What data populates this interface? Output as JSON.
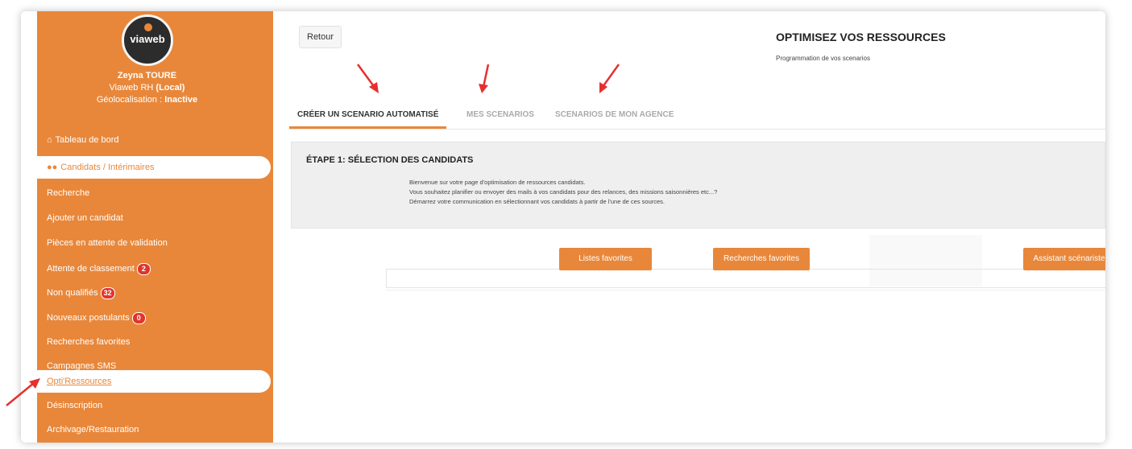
{
  "sidebar": {
    "logo_text": "viaweb",
    "user_name": "Zeyna TOURE",
    "user_role_prefix": "Viaweb RH ",
    "user_role_suffix": "(Local)",
    "geo_prefix": "Géolocalisation : ",
    "geo_status": "Inactive",
    "items": [
      {
        "label": "Tableau de bord",
        "icon": "home-icon"
      },
      {
        "label": "Candidats / Intérimaires",
        "icon": "users-icon"
      },
      {
        "label": "Recherche"
      },
      {
        "label": "Ajouter un candidat"
      },
      {
        "label": "Pièces en attente de validation"
      },
      {
        "label": "Attente de classement",
        "badge": "2"
      },
      {
        "label": "Non qualifiés",
        "badge": "32"
      },
      {
        "label": "Nouveaux postulants",
        "badge": "0"
      },
      {
        "label": "Recherches favorites"
      },
      {
        "label": "Campagnes SMS"
      },
      {
        "label": "Opti'Ressources"
      },
      {
        "label": "Désinscription"
      },
      {
        "label": "Archivage/Restauration"
      }
    ]
  },
  "header": {
    "back_label": "Retour",
    "title": "OPTIMISEZ VOS RESSOURCES",
    "subtitle": "Programmation de vos scenarios"
  },
  "tabs": [
    {
      "label": "CRÉER UN SCENARIO AUTOMATISÉ"
    },
    {
      "label": "MES SCENARIOS"
    },
    {
      "label": "SCENARIOS DE MON AGENCE"
    }
  ],
  "step": {
    "title": "ÉTAPE 1: SÉLECTION DES CANDIDATS",
    "lines": [
      "Bienvenue sur votre page d'optimisation de ressources candidats.",
      "Vous souhaitez planifier ou envoyer des mails à vos candidats pour des relances, des missions saisonnières etc...?",
      "Démarrez votre communication en sélectionnant vos candidats à partir de l'une de ces sources."
    ]
  },
  "actions": {
    "favorites_lists": "Listes favorites",
    "favorite_searches": "Recherches favorites",
    "scenario_assistant": "Assistant scénariste"
  },
  "colors": {
    "accent": "#e8873a",
    "badge": "#e0352b",
    "arrow": "#e53030"
  }
}
